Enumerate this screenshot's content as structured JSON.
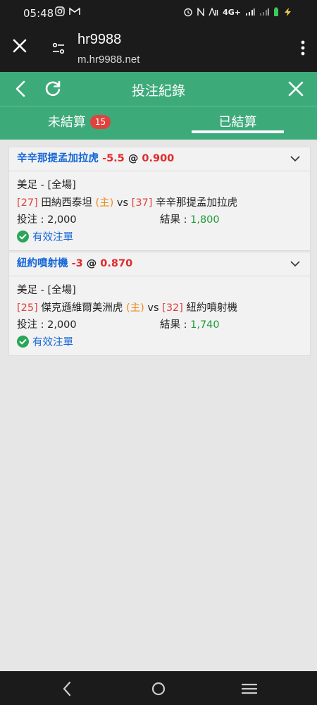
{
  "status": {
    "time": "05:48",
    "network": "4G+"
  },
  "browser": {
    "title": "hr9988",
    "url": "m.hr9988.net"
  },
  "header": {
    "title": "投注紀錄"
  },
  "tabs": [
    {
      "label": "未結算",
      "badge": "15"
    },
    {
      "label": "已結算"
    }
  ],
  "bets": [
    {
      "team": "辛辛那提孟加拉虎",
      "handicap": "-5.5",
      "at": "@",
      "odds": "0.900",
      "league": "美足 - [全場]",
      "home_num": "[27]",
      "home_name": "田納西泰坦",
      "home_tag": "(主)",
      "vs": "vs",
      "away_num": "[37]",
      "away_name": "辛辛那提孟加拉虎",
      "stake_label": "投注 : 2,000",
      "result_label": "結果 : ",
      "result_value": "1,800",
      "status": "有效注單"
    },
    {
      "team": "紐約噴射機",
      "handicap": "-3",
      "at": "@",
      "odds": "0.870",
      "league": "美足 - [全場]",
      "home_num": "[25]",
      "home_name": "傑克遜維爾美洲虎",
      "home_tag": "(主)",
      "vs": "vs",
      "away_num": "[32]",
      "away_name": "紐約噴射機",
      "stake_label": "投注 : 2,000",
      "result_label": "結果 : ",
      "result_value": "1,740",
      "status": "有效注單"
    }
  ],
  "colors": {
    "brand_green": "#3daa7a",
    "team_blue": "#1466d6",
    "odds_red": "#e02b2b",
    "win_green": "#1d9a3a",
    "home_orange": "#f08a1c"
  }
}
